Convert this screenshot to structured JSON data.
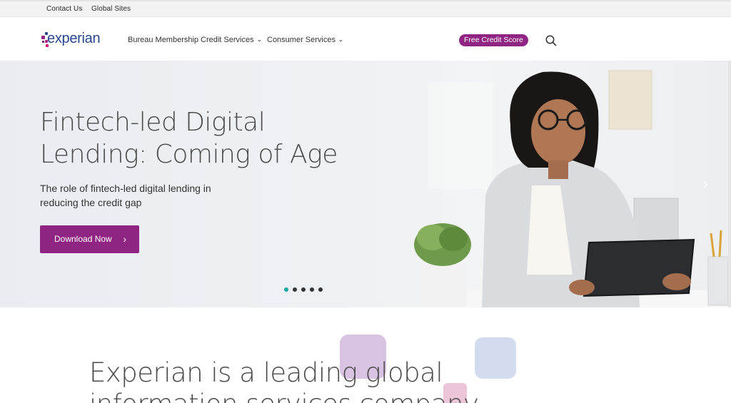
{
  "utility_bar": {
    "contact_us": "Contact Us",
    "global_sites": "Global Sites"
  },
  "header": {
    "logo_text": "experian",
    "nav": [
      {
        "label": "Bureau Membership",
        "has_dropdown": false
      },
      {
        "label": "Credit Services",
        "has_dropdown": true
      },
      {
        "label": "Consumer Services",
        "has_dropdown": true
      }
    ],
    "free_credit_score": "Free Credit Score",
    "search_icon": "search-icon"
  },
  "hero": {
    "title": "Fintech-led Digital Lending: Coming of Age",
    "subtitle": "The role of fintech-led digital lending in reducing the credit gap",
    "cta_label": "Download Now",
    "cta_icon": "chevron-right-icon",
    "next_icon": "chevron-right-icon",
    "carousel": {
      "slide_count": 5,
      "active_index": 0
    }
  },
  "about": {
    "title": "Experian is a leading global information services company"
  },
  "colors": {
    "brand_purple": "#8f2483",
    "logo_blue": "#26478d",
    "active_dot": "#1ba6a6"
  }
}
